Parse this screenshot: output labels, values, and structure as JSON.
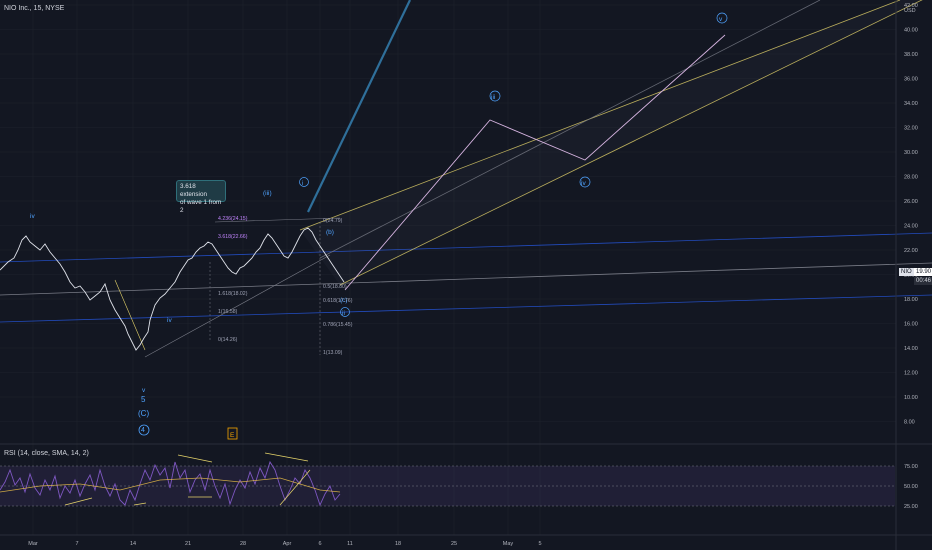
{
  "header": {
    "title": "NIO Inc., 15, NYSE"
  },
  "axis": {
    "currency": "USD",
    "price_labels": [
      "42.00",
      "40.00",
      "38.00",
      "36.00",
      "34.00",
      "32.00",
      "30.00",
      "28.00",
      "26.00",
      "24.00",
      "22.00",
      "20.00",
      "18.00",
      "16.00",
      "14.00",
      "12.00",
      "10.00",
      "8.00"
    ],
    "rsi_labels": [
      "75.00",
      "50.00",
      "25.00"
    ],
    "time_labels": [
      "Mar",
      "7",
      "14",
      "21",
      "28",
      "Apr",
      "6",
      "11",
      "18",
      "25",
      "May",
      "5"
    ]
  },
  "price_tags": {
    "symbol": "NIO",
    "last": "19.90",
    "countdown": "00:46"
  },
  "callout": {
    "line1": "3.618 extension",
    "line2": "of wave 1 from 2"
  },
  "rsi": {
    "label": "RSI (14, close, SMA, 14, 2)"
  },
  "wave_labels": {
    "iv_top": "iv",
    "c5": "5",
    "cC": "(C)",
    "c4": "4",
    "iv_low": "iv",
    "v_low": "v",
    "i_top": "i",
    "iii_mid": "(iii)",
    "iii_big": "iii",
    "iv_big": "iv",
    "v_big": "v",
    "b": "(b)",
    "c": "(c)",
    "ii_c": "ii",
    "e_tag": "E"
  },
  "fib_labels": {
    "f1": "4.236(24.15)",
    "f2": "3.618(22.66)",
    "f3": "1.618(18.02)",
    "f4": "1(16.58)",
    "f5": "0(14.26)",
    "f6": "0.5(18.80)",
    "f7": "0.618(17.76)",
    "f8": "0.786(15.45)",
    "f9": "1(13.09)",
    "f10": "0(24.79)"
  }
}
